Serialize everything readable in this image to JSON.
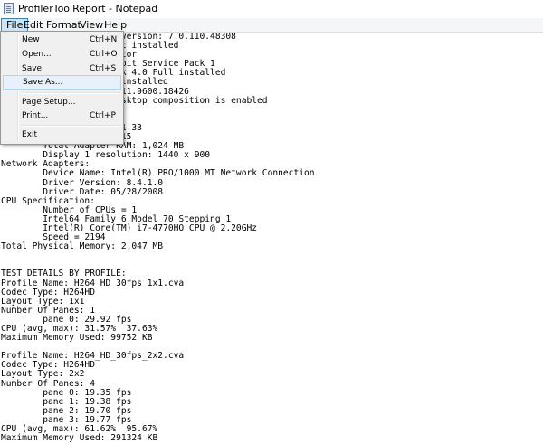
{
  "window": {
    "title": "ProfilerToolReport - Notepad"
  },
  "menubar": {
    "file": "File",
    "edit": "Edit",
    "format": "Format",
    "view": "View",
    "help": "Help"
  },
  "file_menu": {
    "new_label": "New",
    "new_shortcut": "Ctrl+N",
    "open_label": "Open...",
    "open_shortcut": "Ctrl+O",
    "save_label": "Save",
    "save_shortcut": "Ctrl+S",
    "save_as_label": "Save As...",
    "page_setup_label": "Page Setup...",
    "print_label": "Print...",
    "print_shortcut": "Ctrl+P",
    "exit_label": "Exit"
  },
  "document": {
    "text": "                       version: 7.0.110.48308\n                  nt not installed\n                  nstrator\n                  7 64-bit Service Pack 1\n                  mework 4.0 Full installed\n                  11.0 installed\n                  n: 9.11.9600.18426\n                  e: Desktop composition is enabled\n                  ecs:\n                  GA 3D\n                  8.15.1.33\n                  16/2015\n        Total Adapter RAM: 1,024 MB\n        Display 1 resolution: 1440 x 900\nNetwork Adapters:\n        Device Name: Intel(R) PRO/1000 MT Network Connection\n        Driver Version: 8.4.1.0\n        Driver Date: 05/28/2008\nCPU Specification:\n        Number of CPUs = 1\n        Intel64 Family 6 Model 70 Stepping 1\n        Intel(R) Core(TM) i7-4770HQ CPU @ 2.20GHz\n        Speed = 2194\nTotal Physical Memory: 2,047 MB\n\n\nTEST DETAILS BY PROFILE:\nProfile Name: H264_HD_30fps_1x1.cva\nCodec Type: H264HD\nLayout Type: 1x1\nNumber Of Panes: 1\n        pane 0: 29.92 fps\nCPU (avg, max): 31.57%  37.63%\nMaximum Memory Used: 99752 KB\n\nProfile Name: H264_HD_30fps_2x2.cva\nCodec Type: H264HD\nLayout Type: 2x2\nNumber Of Panes: 4\n        pane 0: 19.35 fps\n        pane 1: 19.38 fps\n        pane 2: 19.70 fps\n        pane 3: 19.77 fps\nCPU (avg, max): 61.62%  95.67%\nMaximum Memory Used: 291324 KB"
  }
}
